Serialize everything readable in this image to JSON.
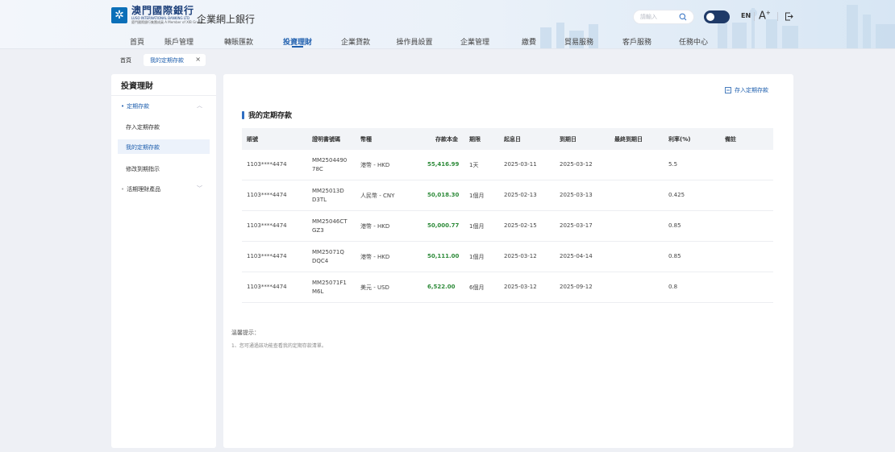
{
  "header": {
    "bank_name_cn": "澳門國際銀行",
    "bank_name_en": "LUSO INTERNATIONAL BANKING LTD",
    "bank_sub": "廈門國際銀行集團成員 A Member of XIB Group",
    "system_title": "企業網上銀行",
    "search_placeholder": "請輸入",
    "lang": "EN",
    "font_size_label": "A+",
    "colors": {
      "accent": "#1f5fae",
      "toggle": "#1f3a68",
      "amount_green": "#2e8b3a"
    }
  },
  "nav": {
    "items": [
      {
        "label": "首頁"
      },
      {
        "label": "賬戶管理"
      },
      {
        "label": "轉賬匯款"
      },
      {
        "label": "投資理財",
        "active": true
      },
      {
        "label": "企業貸款"
      },
      {
        "label": "操作員設置"
      },
      {
        "label": "企業管理"
      },
      {
        "label": "繳費"
      },
      {
        "label": "貿易服務"
      },
      {
        "label": "客戶服務"
      },
      {
        "label": "任務中心"
      }
    ]
  },
  "tabs": {
    "home": "首頁",
    "current": "我的定期存款",
    "close": "×"
  },
  "sidebar": {
    "title": "投資理財",
    "groups": [
      {
        "label": "定期存款",
        "expanded": true,
        "items": [
          {
            "label": "存入定期存款"
          },
          {
            "label": "我的定期存款",
            "active": true
          },
          {
            "label": "修改到期指示"
          }
        ]
      },
      {
        "label": "活期理財產品",
        "expanded": false,
        "items": []
      }
    ]
  },
  "main": {
    "deposit_link": "存入定期存款",
    "section_title": "我的定期存款",
    "table": {
      "headers": [
        "賬號",
        "證明書號碼",
        "幣種",
        "存款本金",
        "期限",
        "起息日",
        "到期日",
        "最終到期日",
        "利率(%)",
        "備註"
      ],
      "rows": [
        {
          "account": "1103****4474",
          "cert": "MM250449078C",
          "currency": "港幣 - HKD",
          "amount": "55,416.99",
          "term": "1天",
          "start": "2025-03-11",
          "end": "2025-03-12",
          "final": "",
          "rate": "5.5",
          "remark": ""
        },
        {
          "account": "1103****4474",
          "cert": "MM25013DD3TL",
          "currency": "人民幣 - CNY",
          "amount": "50,018.30",
          "term": "1個月",
          "start": "2025-02-13",
          "end": "2025-03-13",
          "final": "",
          "rate": "0.425",
          "remark": ""
        },
        {
          "account": "1103****4474",
          "cert": "MM25046CTGZ3",
          "currency": "港幣 - HKD",
          "amount": "50,000.77",
          "term": "1個月",
          "start": "2025-02-15",
          "end": "2025-03-17",
          "final": "",
          "rate": "0.85",
          "remark": ""
        },
        {
          "account": "1103****4474",
          "cert": "MM25071QDQC4",
          "currency": "港幣 - HKD",
          "amount": "50,111.00",
          "term": "1個月",
          "start": "2025-03-12",
          "end": "2025-04-14",
          "final": "",
          "rate": "0.85",
          "remark": ""
        },
        {
          "account": "1103****4474",
          "cert": "MM25071F1M6L",
          "currency": "美元 - USD",
          "amount": "6,522.00",
          "term": "6個月",
          "start": "2025-03-12",
          "end": "2025-09-12",
          "final": "",
          "rate": "0.8",
          "remark": ""
        }
      ]
    },
    "tips": {
      "title": "溫馨提示：",
      "items": [
        "1、您可通過該功能查看我的定期存款清單。"
      ]
    }
  }
}
